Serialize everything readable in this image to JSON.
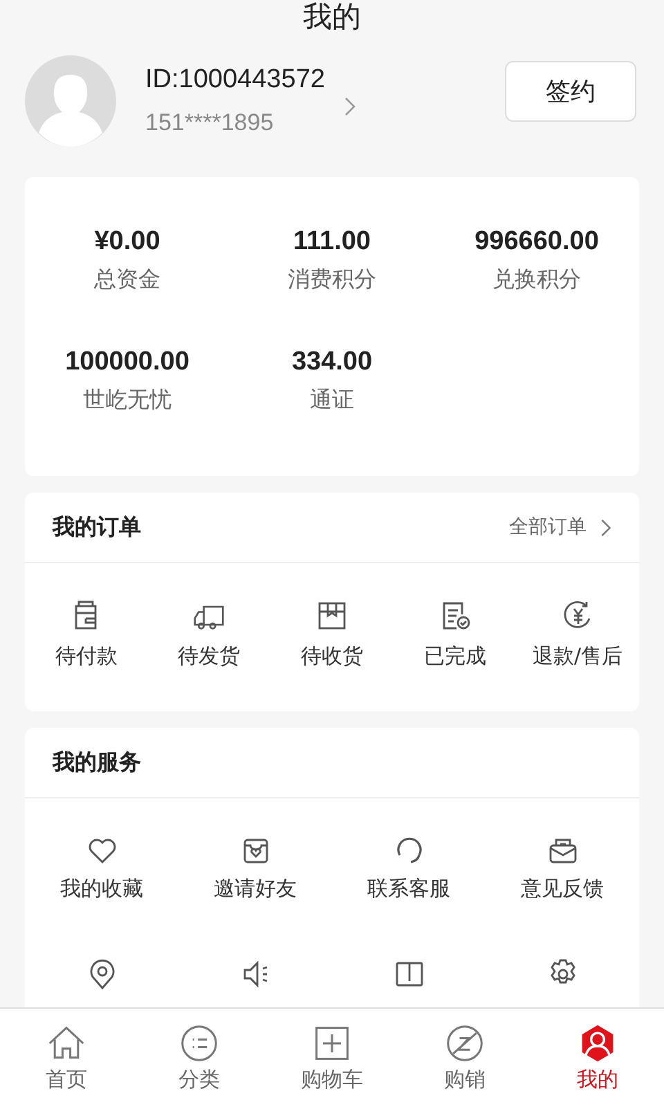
{
  "title": "我的",
  "profile": {
    "id": "ID:1000443572",
    "phone": "151****1895",
    "sign_button": "签约"
  },
  "assets": [
    {
      "value": "¥0.00",
      "label": "总资金"
    },
    {
      "value": "111.00",
      "label": "消费积分"
    },
    {
      "value": "996660.00",
      "label": "兑换积分"
    },
    {
      "value": "100000.00",
      "label": "世屹无忧"
    },
    {
      "value": "334.00",
      "label": "通证"
    }
  ],
  "orders": {
    "title": "我的订单",
    "all_link": "全部订单",
    "items": [
      {
        "label": "待付款"
      },
      {
        "label": "待发货"
      },
      {
        "label": "待收货"
      },
      {
        "label": "已完成"
      },
      {
        "label": "退款/售后"
      }
    ]
  },
  "services": {
    "title": "我的服务",
    "items": [
      {
        "label": "我的收藏"
      },
      {
        "label": "邀请好友"
      },
      {
        "label": "联系客服"
      },
      {
        "label": "意见反馈"
      }
    ]
  },
  "tabs": [
    {
      "label": "首页",
      "selected": false
    },
    {
      "label": "分类",
      "selected": false
    },
    {
      "label": "购物车",
      "selected": false
    },
    {
      "label": "购销",
      "selected": false
    },
    {
      "label": "我的",
      "selected": true
    }
  ]
}
